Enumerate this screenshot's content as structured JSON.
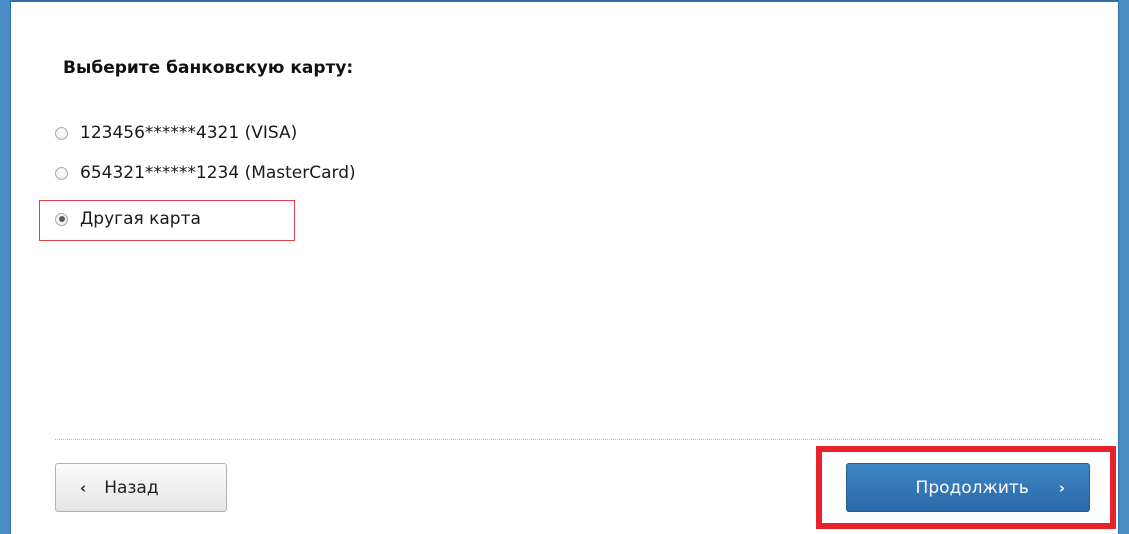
{
  "form": {
    "title": "Выберите банковскую карту:",
    "options": [
      {
        "label": "123456******4321 (VISA)",
        "selected": false
      },
      {
        "label": "654321******1234 (MasterCard)",
        "selected": false
      },
      {
        "label": "Другая карта",
        "selected": true
      }
    ]
  },
  "footer": {
    "back_label": "Назад",
    "back_icon": "‹",
    "continue_label": "Продолжить",
    "continue_icon": "›"
  },
  "colors": {
    "frame_border": "#2f6fae",
    "primary_button": "#2f76b6",
    "annotation_red": "#e8222b"
  }
}
